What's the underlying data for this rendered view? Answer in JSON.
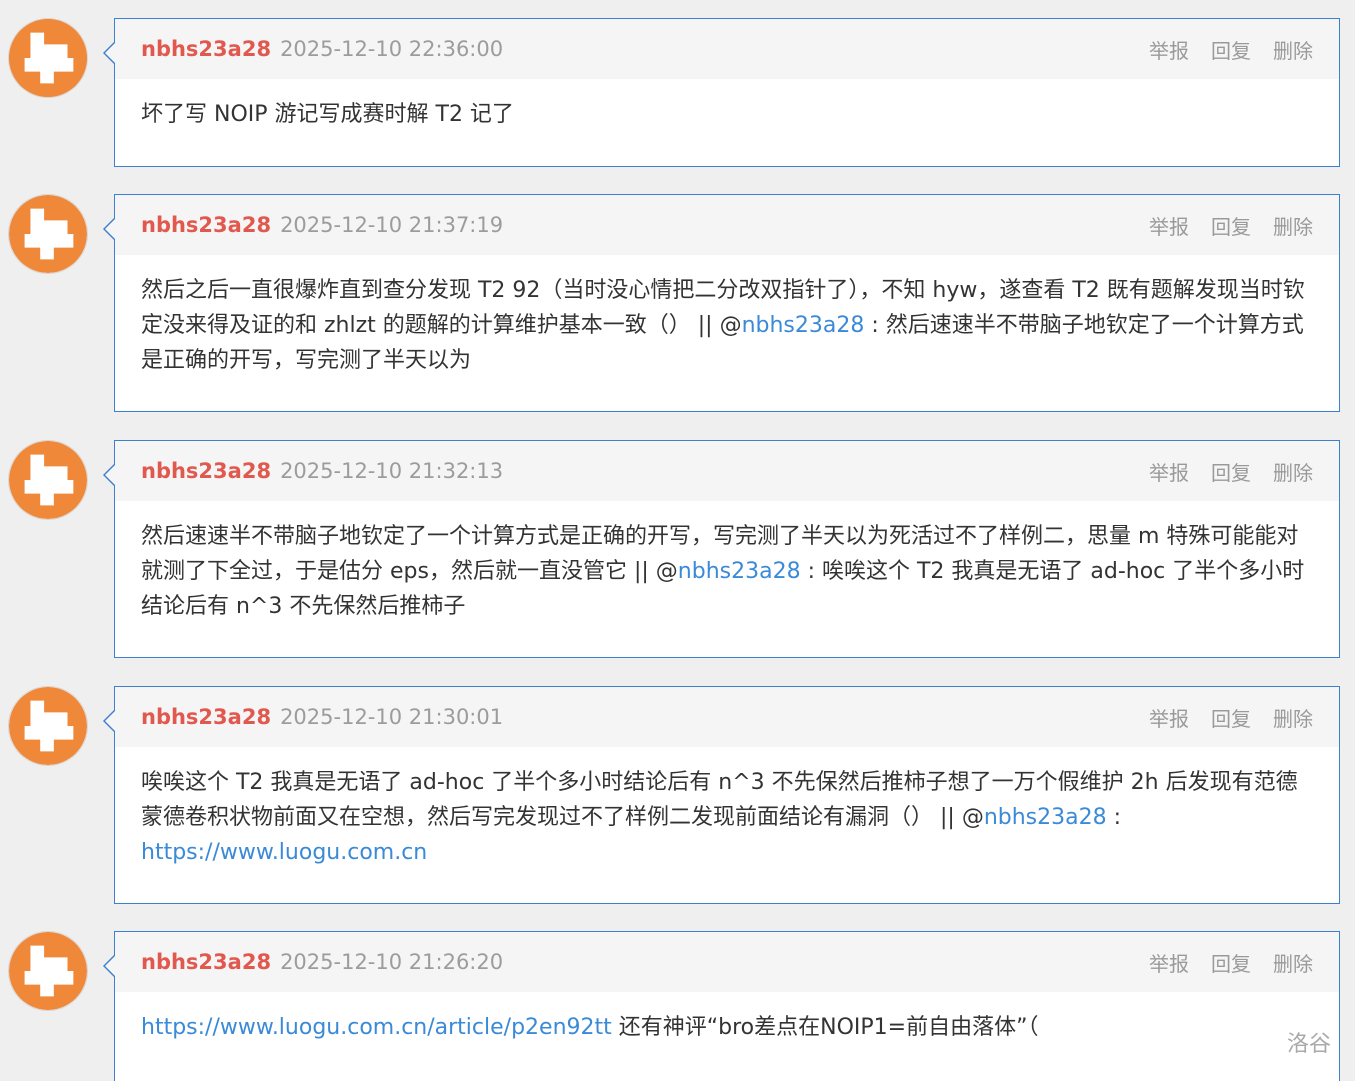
{
  "actions": {
    "report": "举报",
    "reply": "回复",
    "delete": "删除"
  },
  "colors": {
    "username": "#e1594e",
    "link": "#3a8ad8",
    "card_border": "#3d7fd0",
    "avatar": "#f0883a"
  },
  "watermark": "洛谷",
  "comments": [
    {
      "user": "nbhs23a28",
      "time": "2025-12-10 22:36:00",
      "text_a": "坏了写 NOIP 游记写成赛时解 T2 记了",
      "mention": "",
      "text_b": "",
      "url": ""
    },
    {
      "user": "nbhs23a28",
      "time": "2025-12-10 21:37:19",
      "text_a": "然后之后一直很爆炸直到查分发现 T2 92（当时没心情把二分改双指针了），不知 hyw，遂查看 T2 既有题解发现当时钦定没来得及证的和 zhlzt 的题解的计算维护基本一致（） || @",
      "mention": "nbhs23a28",
      "text_b": " : 然后速速半不带脑子地钦定了一个计算方式是正确的开写，写完测了半天以为",
      "url": ""
    },
    {
      "user": "nbhs23a28",
      "time": "2025-12-10 21:32:13",
      "text_a": "然后速速半不带脑子地钦定了一个计算方式是正确的开写，写完测了半天以为死活过不了样例二，思量 m 特殊可能能对就测了下全过，于是估分 eps，然后就一直没管它 || @",
      "mention": "nbhs23a28",
      "text_b": " : 唉唉这个 T2 我真是无语了 ad-hoc 了半个多小时结论后有 n^3 不先保然后推柿子",
      "url": ""
    },
    {
      "user": "nbhs23a28",
      "time": "2025-12-10 21:30:01",
      "text_a": "唉唉这个 T2 我真是无语了 ad-hoc 了半个多小时结论后有 n^3 不先保然后推柿子想了一万个假维护 2h 后发现有范德蒙德卷积状物前面又在空想，然后写完发现过不了样例二发现前面结论有漏洞（） || @",
      "mention": "nbhs23a28",
      "text_b": " : ",
      "url": "https://www.luogu.com.cn"
    },
    {
      "user": "nbhs23a28",
      "time": "2025-12-10 21:26:20",
      "text_a": "",
      "mention": "",
      "text_b": "",
      "url_first": "https://www.luogu.com.cn/article/p2en92tt",
      "text_after": " 还有神评“bro差点在NOIP1=前自由落体”（"
    }
  ]
}
